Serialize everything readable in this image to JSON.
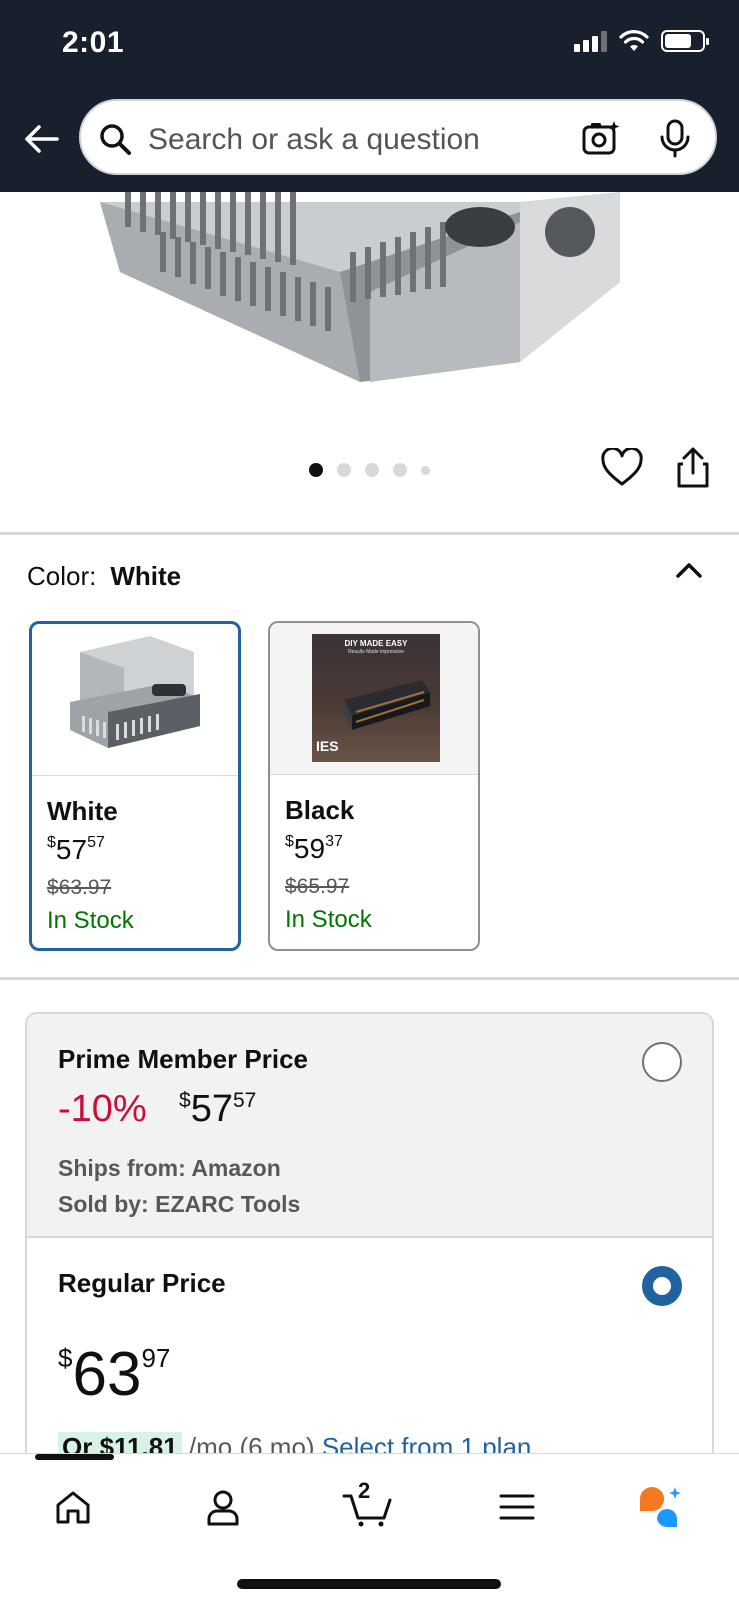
{
  "status_bar": {
    "time": "2:01"
  },
  "search": {
    "placeholder": "Search or ask a question"
  },
  "carousel": {
    "total": 5,
    "active_index": 0
  },
  "color_selector": {
    "label": "Color:",
    "selected": "White",
    "options": [
      {
        "name": "White",
        "price_whole": "57",
        "price_cents": "57",
        "price_symbol": "$",
        "list_price": "$63.97",
        "availability": "In Stock",
        "selected": true
      },
      {
        "name": "Black",
        "price_whole": "59",
        "price_cents": "37",
        "price_symbol": "$",
        "list_price": "$65.97",
        "availability": "In Stock",
        "selected": false,
        "image_text": {
          "line1": "DIY MADE EASY",
          "line2": "Results Made impressive",
          "brand": "IES"
        }
      }
    ]
  },
  "price_options": {
    "prime": {
      "title": "Prime Member Price",
      "discount": "-10%",
      "price_symbol": "$",
      "price_whole": "57",
      "price_cents": "57",
      "ships_from": "Ships from: Amazon",
      "sold_by": "Sold by: EZARC Tools",
      "selected": false
    },
    "regular": {
      "title": "Regular Price",
      "price_symbol": "$",
      "price_whole": "63",
      "price_cents": "97",
      "selected": true,
      "installment_amount": "Or $11.81",
      "installment_term": "/mo (6 mo)",
      "installment_link": "Select from 1 plan"
    }
  },
  "bottom_nav": {
    "items": [
      "home-icon",
      "account-icon",
      "cart-icon",
      "menu-icon",
      "rufus-icon"
    ],
    "cart_count": "2"
  },
  "colors": {
    "header_bg": "#18202d",
    "link_blue": "#2162a1",
    "discount_red": "#cc0c39",
    "stock_green": "#007600"
  }
}
